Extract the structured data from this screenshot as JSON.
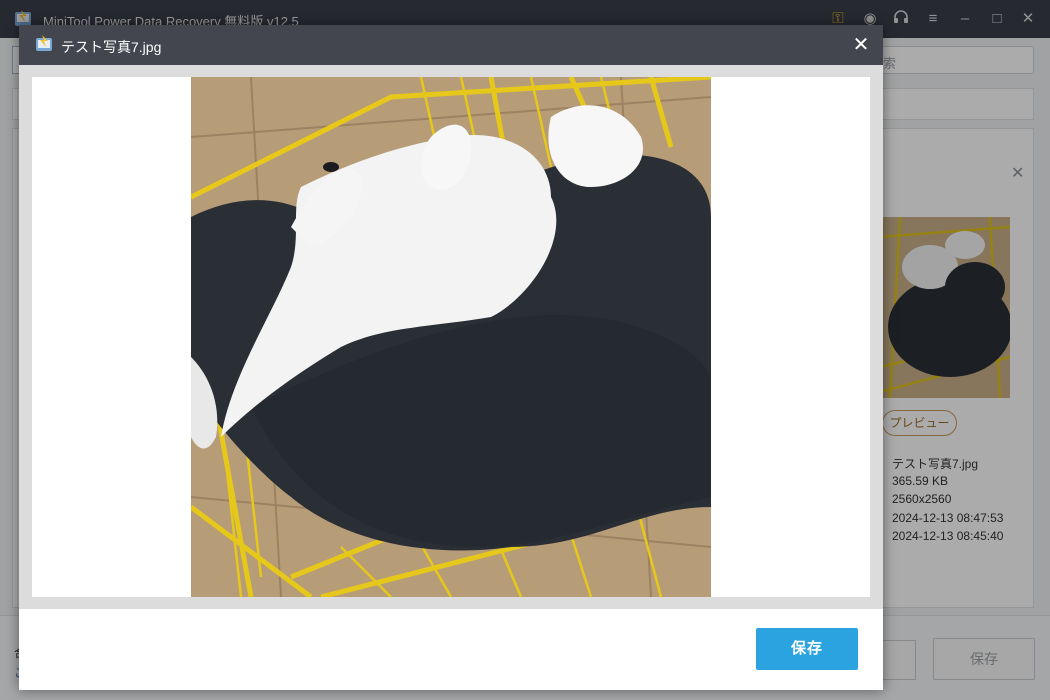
{
  "app": {
    "title": "MiniTool Power Data Recovery 無料版 v12.5",
    "search_placeholder": "索",
    "footer_line1": "合",
    "footer_line2": "こ",
    "save_label": "保存"
  },
  "details": {
    "preview_button": "プレビュー",
    "filename": "テスト写真7.jpg",
    "size": "365.59 KB",
    "dimensions": "2560x2560",
    "modified": "2024-12-13 08:47:53",
    "created": "2024-12-13 08:45:40"
  },
  "modal": {
    "title": "テスト写真7.jpg",
    "close_glyph": "✕",
    "save_label": "保存"
  },
  "icons": {
    "key": "key-icon",
    "disc": "disc-icon",
    "headset": "headset-icon",
    "menu": "menu-icon",
    "minimize": "minimize-icon",
    "maximize": "maximize-icon",
    "close": "close-icon"
  },
  "colors": {
    "titlebar": "#43464f",
    "accent": "#2aa3e0",
    "key_icon": "#e0b030"
  }
}
